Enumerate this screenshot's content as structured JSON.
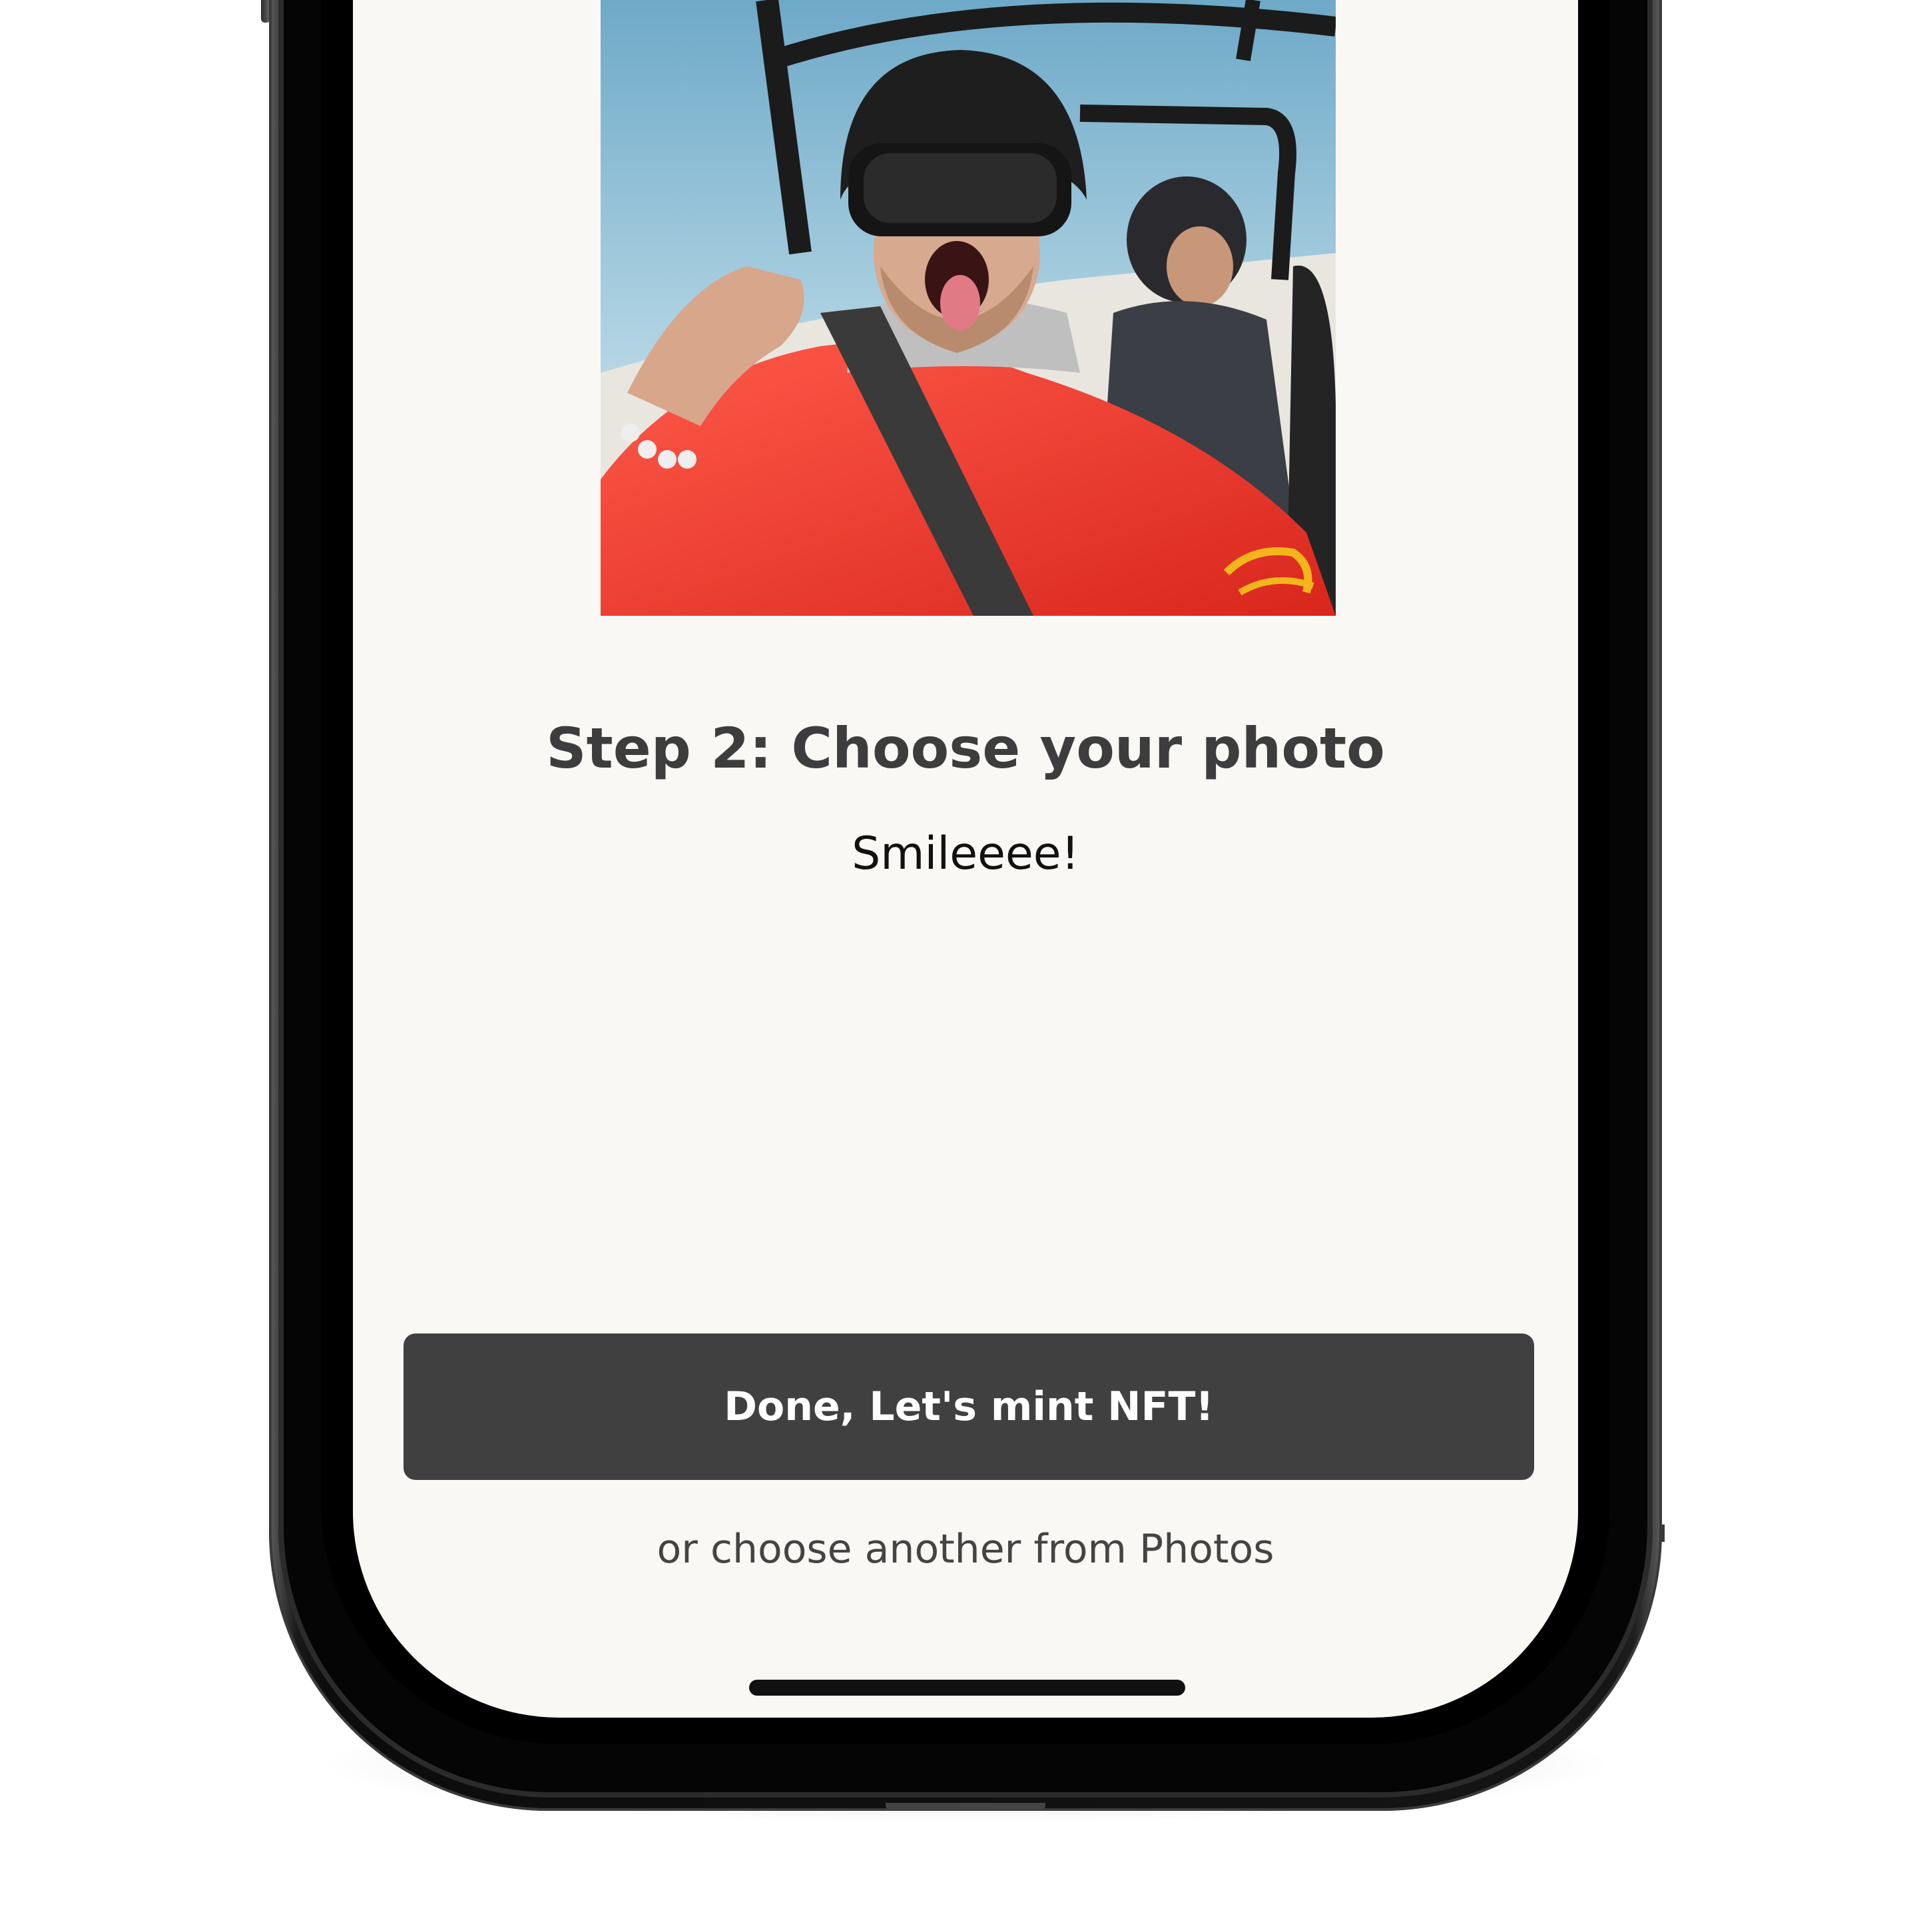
{
  "screen": {
    "photo": {
      "description_icon": "photo-preview"
    },
    "step_title": "Step 2: Choose your photo",
    "subtitle": "Smileeee!",
    "primary_button_label": "Done, Let's mint NFT!",
    "secondary_link_label": "or choose another from Photos"
  },
  "colors": {
    "screen_background": "#f9f8f4",
    "button_background": "#404040",
    "button_text": "#ffffff",
    "title_text": "#3d3d3d",
    "link_text": "#444444",
    "phone_frame": "#000000"
  }
}
